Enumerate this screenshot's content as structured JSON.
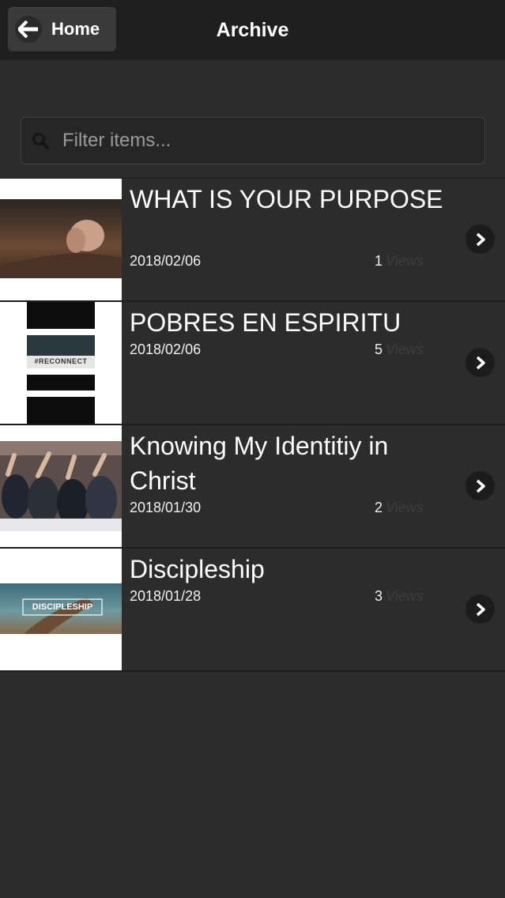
{
  "header": {
    "back_label": "Home",
    "title": "Archive"
  },
  "filter": {
    "placeholder": "Filter items..."
  },
  "items": [
    {
      "title": "WHAT IS YOUR PURPOSE",
      "date": "2018/02/06",
      "count": "1",
      "views_label": "Views"
    },
    {
      "title": "POBRES EN ESPIRITU",
      "date": "2018/02/06",
      "count": "5",
      "views_label": "Views",
      "thumb_text": "#RECONNECT"
    },
    {
      "title": "Knowing My Identitiy in Christ",
      "date": "2018/01/30",
      "count": "2",
      "views_label": "Views"
    },
    {
      "title": "Discipleship",
      "date": "2018/01/28",
      "count": "3",
      "views_label": "Views",
      "thumb_text": "DISCIPLESHIP"
    }
  ]
}
